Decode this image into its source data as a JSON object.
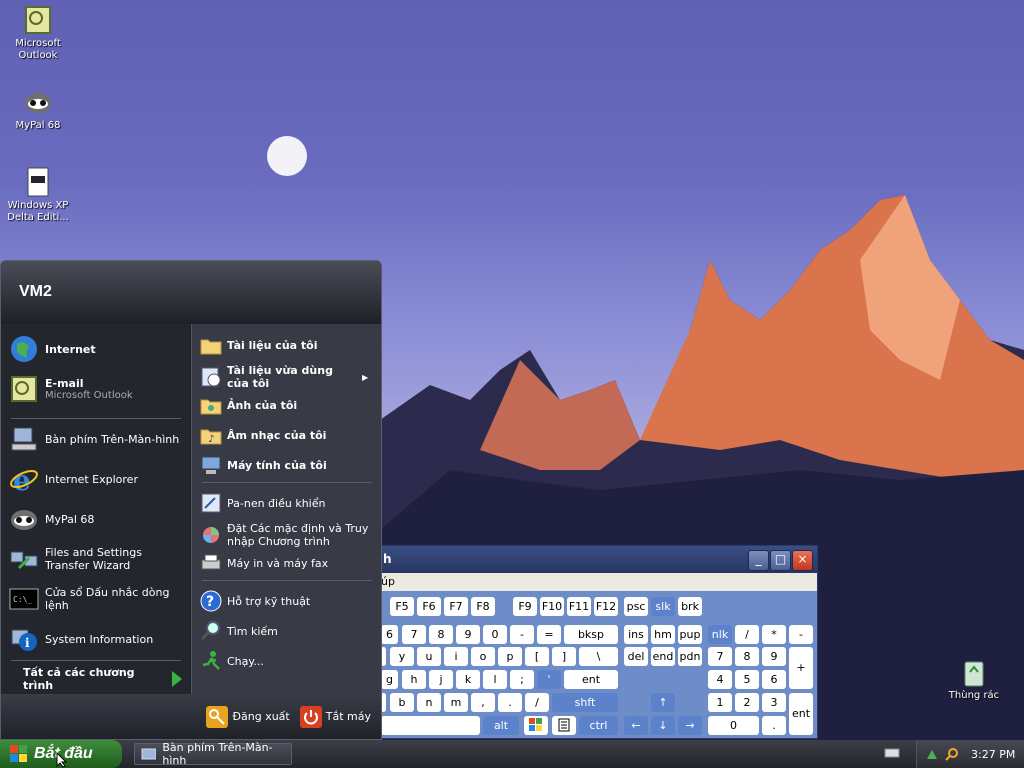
{
  "desktop": {
    "icons": [
      {
        "label": "Microsoft Outlook"
      },
      {
        "label": "MyPal 68"
      },
      {
        "label": "Windows XP Delta Editi..."
      },
      {
        "label": "Thùng rác"
      }
    ]
  },
  "start_menu": {
    "user": "VM2",
    "left": [
      {
        "label": "Internet"
      },
      {
        "label": "E-mail",
        "sub": "Microsoft Outlook"
      },
      {
        "label": "Bàn phím Trên-Màn-hình"
      },
      {
        "label": "Internet Explorer"
      },
      {
        "label": "MyPal 68"
      },
      {
        "label": "Files and Settings Transfer Wizard"
      },
      {
        "label": "Cửa sổ Dấu nhắc dòng lệnh"
      },
      {
        "label": "System Information"
      }
    ],
    "all_programs": "Tất cả các chương trình",
    "right": [
      {
        "label": "Tài liệu của tôi"
      },
      {
        "label": "Tài liệu vừa dùng của tôi"
      },
      {
        "label": "Ảnh của tôi"
      },
      {
        "label": "Âm nhạc của tôi"
      },
      {
        "label": "Máy tính của tôi"
      },
      {
        "label": "Pa-nen điều khiển"
      },
      {
        "label": "Đặt Các mặc định và Truy nhập Chương trình"
      },
      {
        "label": "Máy in và máy fax"
      },
      {
        "label": "Hỗ trợ kỹ thuật"
      },
      {
        "label": "Tìm kiếm"
      },
      {
        "label": "Chạy..."
      }
    ],
    "logoff": "Đăng xuất",
    "shutdown": "Tắt máy"
  },
  "osk": {
    "title_fragment": "h",
    "menu_fragment": "úp",
    "keys": {
      "f5": "F5",
      "f6": "F6",
      "f7": "F7",
      "f8": "F8",
      "f9": "F9",
      "f10": "F10",
      "f11": "F11",
      "f12": "F12",
      "psc": "psc",
      "slk": "slk",
      "brk": "brk",
      "n6": "6",
      "n7": "7",
      "n8": "8",
      "n9": "9",
      "n0": "0",
      "minus": "-",
      "eq": "=",
      "bksp": "bksp",
      "ins": "ins",
      "hm": "hm",
      "pup": "pup",
      "nlk": "nlk",
      "div": "/",
      "mul": "*",
      "sub": "-",
      "y": "y",
      "u": "u",
      "i": "i",
      "o": "o",
      "p": "p",
      "lb": "[",
      "rb": "]",
      "bs": "\\",
      "del": "del",
      "end": "end",
      "pdn": "pdn",
      "np7": "7",
      "np8": "8",
      "np9": "9",
      "plus": "+",
      "g": "g",
      "h": "h",
      "j": "j",
      "k": "k",
      "l": "l",
      "semi": ";",
      "quote": "'",
      "ent": "ent",
      "np4": "4",
      "np5": "5",
      "np6": "6",
      "b": "b",
      "n": "n",
      "m": "m",
      "comma": ",",
      "dot": ".",
      "slash": "/",
      "shft": "shft",
      "up": "↑",
      "np1": "1",
      "np2": "2",
      "np3": "3",
      "npent": "ent",
      "alt": "alt",
      "ctrl": "ctrl",
      "left": "←",
      "down": "↓",
      "right": "→",
      "np0": "0",
      "npdot": "."
    }
  },
  "taskbar": {
    "start": "Bắt đầu",
    "task": "Bàn phím Trên-Màn-hình",
    "clock": "3:27 PM"
  }
}
